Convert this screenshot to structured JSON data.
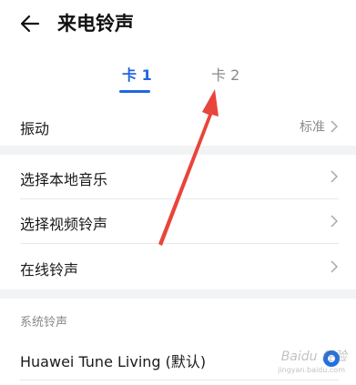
{
  "header": {
    "title": "来电铃声"
  },
  "tabs": [
    {
      "label": "卡 1",
      "active": true
    },
    {
      "label": "卡 2",
      "active": false
    }
  ],
  "vibration": {
    "label": "振动",
    "value": "标准"
  },
  "menu": [
    {
      "label": "选择本地音乐"
    },
    {
      "label": "选择视频铃声"
    },
    {
      "label": "在线铃声"
    }
  ],
  "system": {
    "section_label": "系统铃声",
    "selected_ringtone": "Huawei Tune Living (默认)"
  },
  "colors": {
    "accent": "#2166e0",
    "annotation_arrow": "#e8453c"
  },
  "watermark": {
    "text": "Baidu 经验",
    "sub": "jingyan.baidu.com"
  }
}
